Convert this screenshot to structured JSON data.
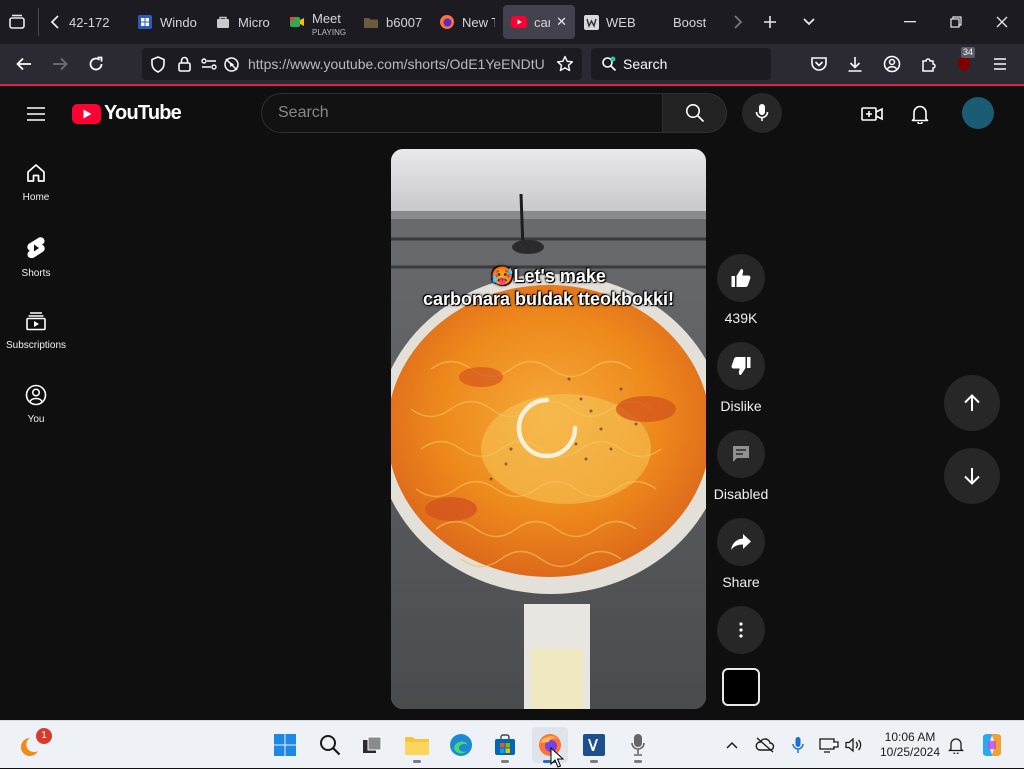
{
  "browser": {
    "tabs": [
      {
        "label": "42-172",
        "icon": "page-icon",
        "active": false
      },
      {
        "label": "Windo",
        "icon": "windows-icon",
        "active": false
      },
      {
        "label": "Micro",
        "icon": "store-icon",
        "active": false
      },
      {
        "label": "Meet",
        "sublabel": "PLAYING",
        "icon": "meet-icon",
        "active": false
      },
      {
        "label": "b6007",
        "icon": "folder-icon",
        "active": false
      },
      {
        "label": "New T",
        "icon": "firefox-icon",
        "active": false
      },
      {
        "label": "car",
        "icon": "youtube-icon",
        "active": true
      },
      {
        "label": "WEB",
        "icon": "web-icon",
        "active": false
      },
      {
        "label": "Boost",
        "icon": "none",
        "active": false
      }
    ],
    "url": "https://www.youtube.com/shorts/OdE1YeENDtU",
    "search_placeholder": "Search",
    "extension_badge": "34",
    "accent_color": "#e2215c"
  },
  "youtube": {
    "logo_text": "YouTube",
    "search_placeholder": "Search",
    "sidebar": [
      {
        "label": "Home",
        "icon": "home-icon"
      },
      {
        "label": "Shorts",
        "icon": "shorts-icon"
      },
      {
        "label": "Subscriptions",
        "icon": "subscriptions-icon"
      },
      {
        "label": "You",
        "icon": "you-icon"
      }
    ],
    "video": {
      "caption_line1": "🥵Let's make",
      "caption_line2": "carbonara buldak tteokbokki!",
      "loading": true
    },
    "actions": [
      {
        "label": "439K",
        "icon": "thumbs-up-icon"
      },
      {
        "label": "Dislike",
        "icon": "thumbs-down-icon"
      },
      {
        "label": "Disabled",
        "icon": "comment-icon"
      },
      {
        "label": "Share",
        "icon": "share-icon"
      },
      {
        "label": "",
        "icon": "more-icon"
      }
    ]
  },
  "taskbar": {
    "weather_badge": "1",
    "time": "10:06 AM",
    "date": "10/25/2024"
  }
}
